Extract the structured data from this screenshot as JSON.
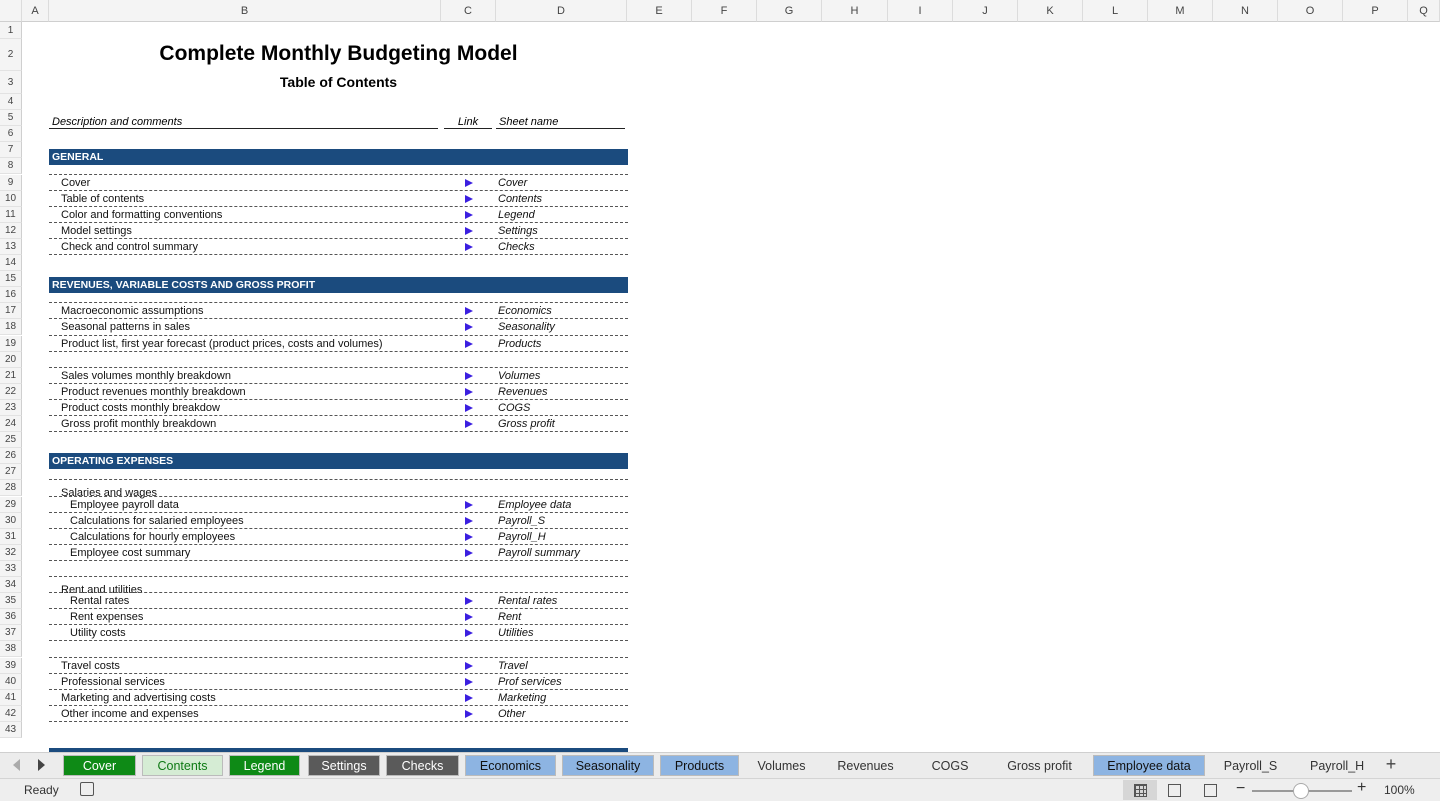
{
  "columns": [
    "A",
    "B",
    "C",
    "D",
    "E",
    "F",
    "G",
    "H",
    "I",
    "J",
    "K",
    "L",
    "M",
    "N",
    "O",
    "P",
    "Q"
  ],
  "rows": [
    "1",
    "2",
    "3",
    "4",
    "5",
    "6",
    "7",
    "8",
    "9",
    "10",
    "11",
    "12",
    "13",
    "14",
    "15",
    "16",
    "17",
    "18",
    "19",
    "20",
    "21",
    "22",
    "23",
    "24",
    "25",
    "26",
    "27",
    "28",
    "29",
    "30",
    "31",
    "32",
    "33",
    "34",
    "35",
    "36",
    "37",
    "38",
    "39",
    "40",
    "41",
    "42",
    "43"
  ],
  "title": "Complete Monthly Budgeting Model",
  "subtitle": "Table of Contents",
  "headers": {
    "description": "Description and comments",
    "link": "Link",
    "sheet": "Sheet name"
  },
  "sections": {
    "general": "GENERAL",
    "revenues": "REVENUES, VARIABLE COSTS AND GROSS PROFIT",
    "opex": "OPERATING EXPENSES"
  },
  "groups": {
    "salaries": "Salaries and wages",
    "rent": "Rent and utilities"
  },
  "items": [
    {
      "desc": "Cover",
      "sheet": "Cover"
    },
    {
      "desc": "Table of contents",
      "sheet": "Contents"
    },
    {
      "desc": "Color and formatting conventions",
      "sheet": "Legend"
    },
    {
      "desc": "Model settings",
      "sheet": "Settings"
    },
    {
      "desc": "Check and control summary",
      "sheet": "Checks"
    },
    {
      "desc": "Macroeconomic assumptions",
      "sheet": "Economics"
    },
    {
      "desc": "Seasonal patterns in sales",
      "sheet": "Seasonality"
    },
    {
      "desc": "Product list, first year forecast (product prices, costs and volumes)",
      "sheet": "Products"
    },
    {
      "desc": "Sales volumes monthly breakdown",
      "sheet": "Volumes"
    },
    {
      "desc": "Product revenues monthly breakdown",
      "sheet": "Revenues"
    },
    {
      "desc": "Product costs monthly breakdow",
      "sheet": "COGS"
    },
    {
      "desc": "Gross profit monthly breakdown",
      "sheet": "Gross profit"
    },
    {
      "desc": "Employee payroll data",
      "sheet": "Employee data"
    },
    {
      "desc": "Calculations for salaried employees",
      "sheet": "Payroll_S"
    },
    {
      "desc": "Calculations for hourly employees",
      "sheet": "Payroll_H"
    },
    {
      "desc": "Employee cost summary",
      "sheet": "Payroll summary"
    },
    {
      "desc": "Rental rates",
      "sheet": "Rental rates"
    },
    {
      "desc": "Rent expenses",
      "sheet": "Rent"
    },
    {
      "desc": "Utility costs",
      "sheet": "Utilities"
    },
    {
      "desc": "Travel costs",
      "sheet": "Travel"
    },
    {
      "desc": "Professional services",
      "sheet": "Prof services"
    },
    {
      "desc": "Marketing and advertising costs",
      "sheet": "Marketing"
    },
    {
      "desc": "Other income and expenses",
      "sheet": "Other"
    }
  ],
  "tabs": [
    {
      "label": "Cover",
      "bg": "#0e8a16",
      "fg": "#ffffff"
    },
    {
      "label": "Contents",
      "bg": "#d5ecd4",
      "fg": "#0e7a14"
    },
    {
      "label": "Legend",
      "bg": "#0e8a16",
      "fg": "#ffffff"
    },
    {
      "label": "Settings",
      "bg": "#5a5a5a",
      "fg": "#ffffff"
    },
    {
      "label": "Checks",
      "bg": "#5a5a5a",
      "fg": "#ffffff"
    },
    {
      "label": "Economics",
      "bg": "#8db4e2",
      "fg": "#111111"
    },
    {
      "label": "Seasonality",
      "bg": "#8db4e2",
      "fg": "#111111"
    },
    {
      "label": "Products",
      "bg": "#8db4e2",
      "fg": "#111111"
    },
    {
      "label": "Volumes",
      "bg": "#ececec",
      "fg": "#333333"
    },
    {
      "label": "Revenues",
      "bg": "#ececec",
      "fg": "#333333"
    },
    {
      "label": "COGS",
      "bg": "#ececec",
      "fg": "#333333"
    },
    {
      "label": "Gross profit",
      "bg": "#ececec",
      "fg": "#333333"
    },
    {
      "label": "Employee data",
      "bg": "#8db4e2",
      "fg": "#111111"
    },
    {
      "label": "Payroll_S",
      "bg": "#ececec",
      "fg": "#333333"
    },
    {
      "label": "Payroll_H",
      "bg": "#ececec",
      "fg": "#333333"
    }
  ],
  "add_sheet": "+",
  "status": {
    "ready": "Ready",
    "zoom": "100%",
    "minus": "−",
    "plus": "+"
  },
  "colors": {
    "band": "#1b4b7e",
    "arrow": "#3b1fe0"
  }
}
